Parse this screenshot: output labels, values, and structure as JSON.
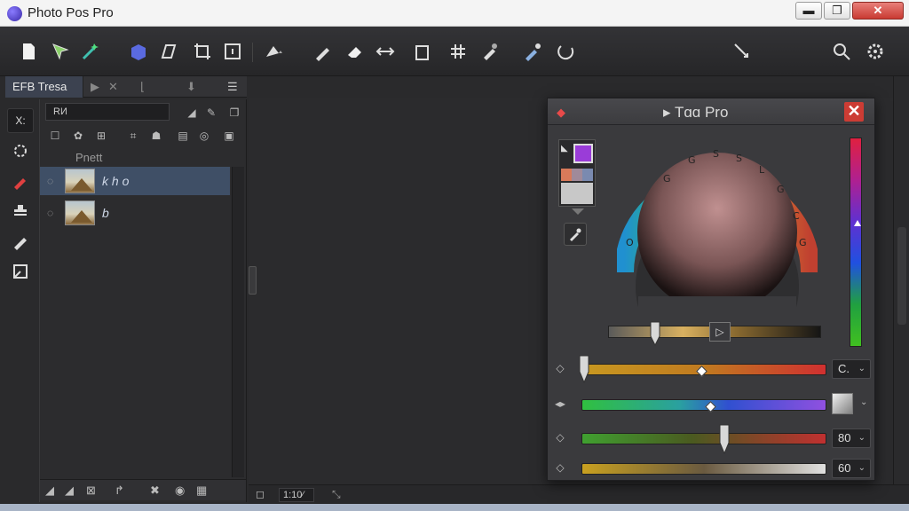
{
  "window": {
    "title": "Photo Pos Pro",
    "min_label": "▬",
    "max_label": "❐",
    "close_label": "✕"
  },
  "toolbar": {
    "icons": [
      "new-file-icon",
      "select-icon",
      "magic-wand-icon",
      "shape-icon",
      "transform-icon",
      "crop-icon",
      "frame-icon",
      "fill-icon",
      "brush-icon",
      "eraser-icon",
      "arrows-icon",
      "copy-icon",
      "grid-icon",
      "clone-icon",
      "picker-icon",
      "rotate-icon",
      "pan-icon",
      "search-icon",
      "settings-icon"
    ]
  },
  "tools": {
    "x_label": "X:"
  },
  "panel": {
    "tab_label": "EFB Tresa",
    "name_field": "RИ",
    "header": "Pnett",
    "layers": [
      {
        "name": "k h o"
      },
      {
        "name": "b"
      }
    ]
  },
  "statusbar": {
    "zoom": "1:10⁄"
  },
  "color_dialog": {
    "title": "Tɑɑ Pro",
    "close_label": "✕",
    "fg_color": "#9a3cd8",
    "tone_btn": "▷",
    "rows": {
      "r_value": "C.",
      "b_value": "80",
      "a_value": "60"
    },
    "wheel_labels": [
      "G",
      "G",
      "S",
      "S",
      "L",
      "G",
      "C",
      "G",
      "O"
    ]
  }
}
